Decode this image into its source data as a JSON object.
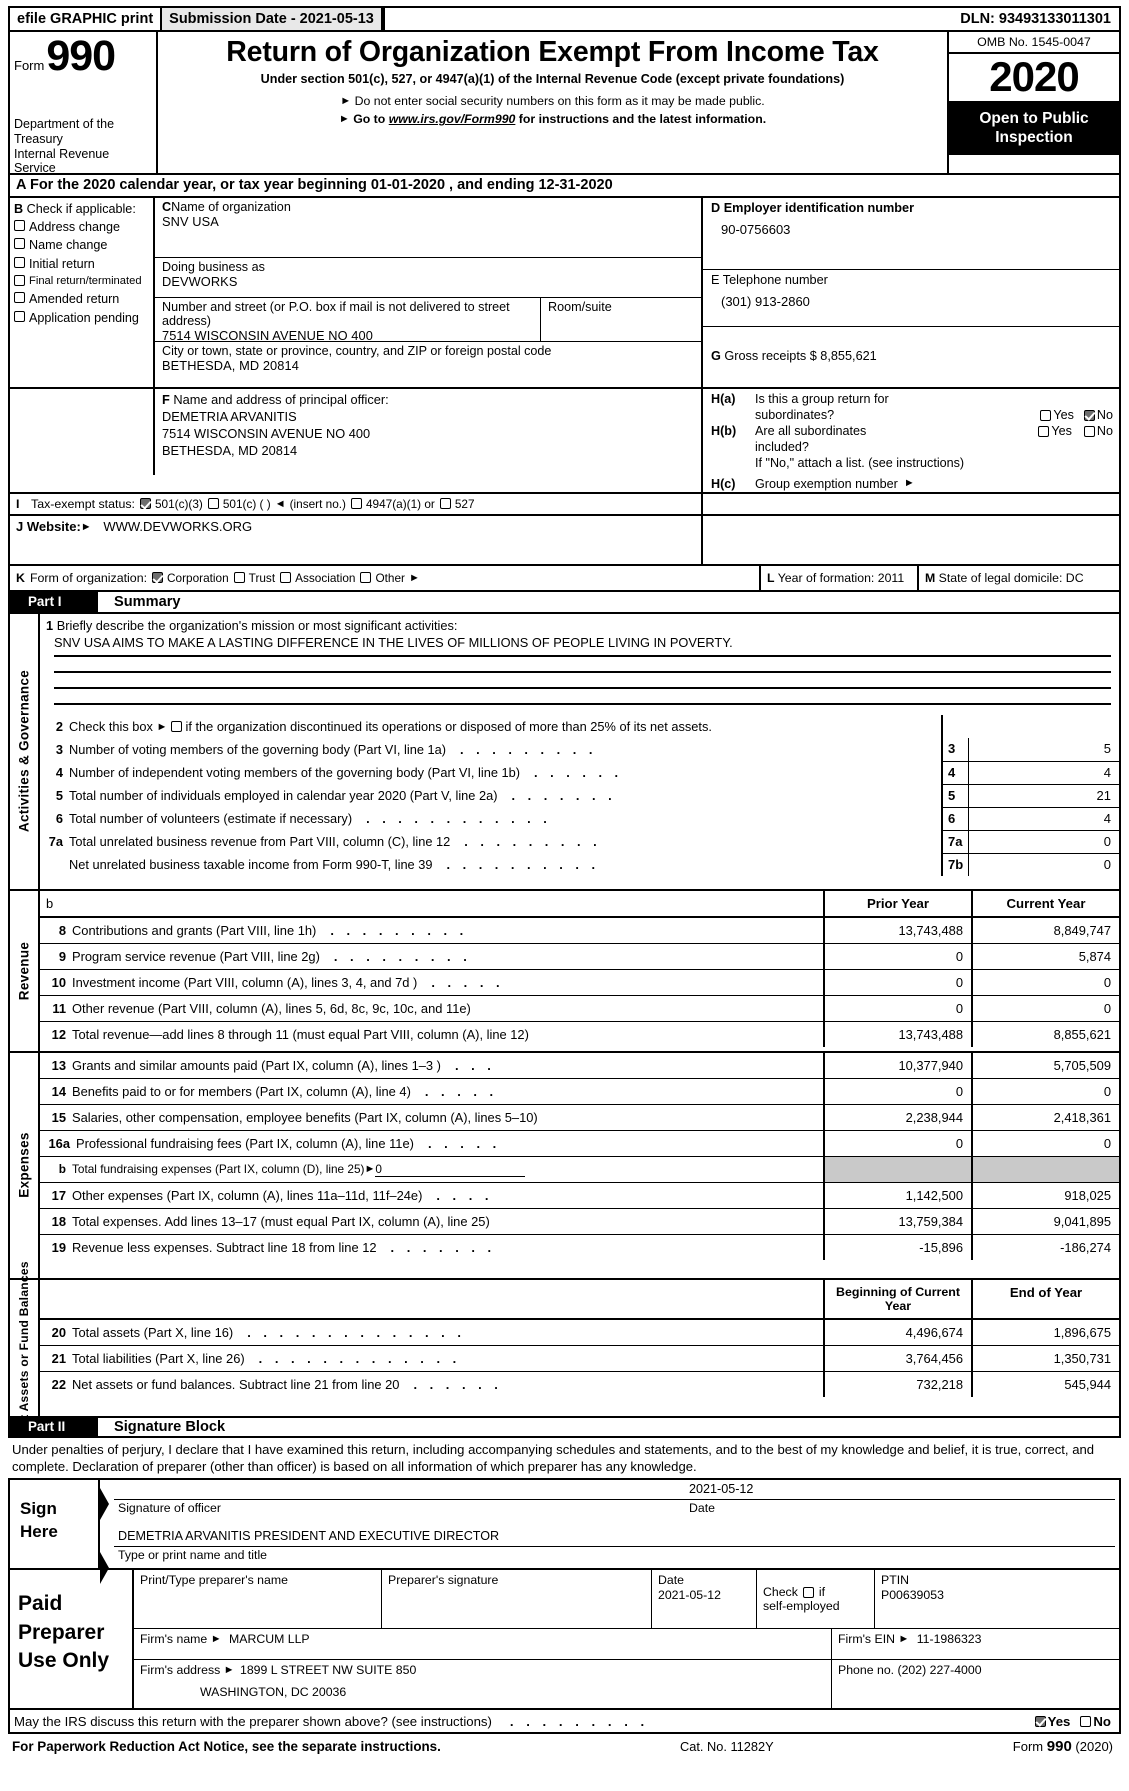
{
  "efile": {
    "print_label": "efile GRAPHIC print",
    "submission_label": "Submission Date - 2021-05-13",
    "dln_label": "DLN: 93493133011301"
  },
  "masthead": {
    "form_word": "Form",
    "form_number": "990",
    "department": "Department of the Treasury Internal Revenue Service",
    "title": "Return of Organization Exempt From Income Tax",
    "subtitle": "Under section 501(c), 527, or 4947(a)(1) of the Internal Revenue Code (except private foundations)",
    "note1": "Do not enter social security numbers on this form as it may be made public.",
    "note2_prefix": "Go to",
    "note2_link": "www.irs.gov/Form990",
    "note2_suffix": "for instructions and the latest information.",
    "omb": "OMB No. 1545-0047",
    "year": "2020",
    "open_to_public": "Open to Public Inspection"
  },
  "line_a": {
    "letter": "A",
    "text": "For the 2020 calendar year, or tax year beginning 01-01-2020   , and ending 12-31-2020"
  },
  "section_b": {
    "letter": "B",
    "heading": "Check if applicable:",
    "items": [
      {
        "label": "Address change",
        "checked": false
      },
      {
        "label": "Name change",
        "checked": false
      },
      {
        "label": "Initial return",
        "checked": false
      },
      {
        "label": "Final return/terminated",
        "checked": false
      },
      {
        "label": "Amended return",
        "checked": false
      },
      {
        "label": "Application pending",
        "checked": false
      }
    ]
  },
  "section_c": {
    "letter": "C",
    "name_label": "Name of organization",
    "name_value": "SNV USA",
    "dba_label": "Doing business as",
    "dba_value": "DEVWORKS",
    "street_label": "Number and street (or P.O. box if mail is not delivered to street address)",
    "street_value": "7514 WISCONSIN AVENUE NO 400",
    "room_label": "Room/suite",
    "room_value": "",
    "city_label": "City or town, state or province, country, and ZIP or foreign postal code",
    "city_value": "BETHESDA, MD  20814"
  },
  "section_d": {
    "letter": "D",
    "ein_label": "Employer identification number",
    "ein_value": "90-0756603",
    "phone_letter": "E",
    "phone_label": "Telephone number",
    "phone_value": "(301) 913-2860",
    "gross_letter": "G",
    "gross_label": "Gross receipts $ 8,855,621"
  },
  "section_f": {
    "letter": "F",
    "label": "Name and address of principal officer:",
    "officer_name": "DEMETRIA ARVANITIS",
    "officer_street": "7514 WISCONSIN AVENUE NO 400",
    "officer_city": "BETHESDA, MD  20814"
  },
  "section_h": {
    "ha_label": "H(a)",
    "ha_q1": "Is this a group return for",
    "ha_q2": "subordinates?",
    "ha_yes": "Yes",
    "ha_no": "No",
    "ha_yes_checked": false,
    "ha_no_checked": true,
    "hb_label": "H(b)",
    "hb_q1": "Are all subordinates",
    "hb_q2": "included?",
    "hb_yes": "Yes",
    "hb_no": "No",
    "hb_yes_checked": false,
    "hb_no_checked": false,
    "hb_note": "If \"No,\" attach a list. (see instructions)",
    "hc_label": "H(c)",
    "hc_text": "Group exemption number"
  },
  "section_i": {
    "letter": "I",
    "label": "Tax-exempt status:",
    "opt1": "501(c)(3)",
    "opt1_checked": true,
    "opt2": "501(c) (   )",
    "opt2_checked": false,
    "opt2_suffix": "(insert no.)",
    "opt3": "4947(a)(1) or",
    "opt3_checked": false,
    "opt4": "527",
    "opt4_checked": false
  },
  "section_j": {
    "letter": "J",
    "label": "Website:",
    "value": "WWW.DEVWORKS.ORG"
  },
  "section_k": {
    "letter": "K",
    "label": "Form of organization:",
    "opt1": "Corporation",
    "opt1_checked": true,
    "opt2": "Trust",
    "opt2_checked": false,
    "opt3": "Association",
    "opt3_checked": false,
    "opt4": "Other",
    "opt4_checked": false,
    "l_label": "Year of formation: 2011",
    "l_letter": "L",
    "m_letter": "M",
    "m_label": "State of legal domicile: DC"
  },
  "part1": {
    "part_label": "Part I",
    "part_title": "Summary",
    "sidetab_activities": "Activities & Governance",
    "sidetab_revenue": "Revenue",
    "sidetab_expenses": "Expenses",
    "sidetab_netassets": "Net Assets or Fund Balances",
    "mission_num": "1",
    "mission_label": "Briefly describe the organization's mission or most significant activities:",
    "mission_text": "SNV USA AIMS TO MAKE A LASTING DIFFERENCE IN THE LIVES OF MILLIONS OF PEOPLE LIVING IN POVERTY.",
    "line2_num": "2",
    "line2_text_a": "Check this box",
    "line2_text_b": "if the organization discontinued its operations or disposed of more than 25% of its net assets.",
    "line2_checked": false,
    "gov_rows": [
      {
        "num": "3",
        "label": "Number of voting members of the governing body (Part VI, line 1a)",
        "dots": ". . . . . . . . .",
        "box": "3",
        "value": "5"
      },
      {
        "num": "4",
        "label": "Number of independent voting members of the governing body (Part VI, line 1b)",
        "dots": ". . . . . .",
        "box": "4",
        "value": "4"
      },
      {
        "num": "5",
        "label": "Total number of individuals employed in calendar year 2020 (Part V, line 2a)",
        "dots": ". . . . . . .",
        "box": "5",
        "value": "21"
      },
      {
        "num": "6",
        "label": "Total number of volunteers (estimate if necessary)",
        "dots": ". . . . . . . . . . . .",
        "box": "6",
        "value": "4"
      },
      {
        "num": "7a",
        "label": "Total unrelated business revenue from Part VIII, column (C), line 12",
        "dots": ". . . . . . . . .",
        "box": "7a",
        "value": "0"
      },
      {
        "num": "",
        "label": "Net unrelated business taxable income from Form 990-T, line 39",
        "dots": ". . . . . . . . . .",
        "box": "7b",
        "value": "0"
      }
    ],
    "stray_b": "b",
    "col_prior": "Prior Year",
    "col_current": "Current Year",
    "col_begin": "Beginning of Current Year",
    "col_end": "End of Year",
    "revenue_rows": [
      {
        "num": "8",
        "label": "Contributions and grants (Part VIII, line 1h)",
        "dots": ". . . . . . . . .",
        "prior": "13,743,488",
        "current": "8,849,747"
      },
      {
        "num": "9",
        "label": "Program service revenue (Part VIII, line 2g)",
        "dots": ". . . . . . . . .",
        "prior": "0",
        "current": "5,874"
      },
      {
        "num": "10",
        "label": "Investment income (Part VIII, column (A), lines 3, 4, and 7d )",
        "dots": ". . . . .",
        "prior": "0",
        "current": "0"
      },
      {
        "num": "11",
        "label": "Other revenue (Part VIII, column (A), lines 5, 6d, 8c, 9c, 10c, and 11e)",
        "dots": "",
        "prior": "0",
        "current": "0"
      },
      {
        "num": "12",
        "label": "Total revenue—add lines 8 through 11 (must equal Part VIII, column (A), line 12)",
        "dots": "",
        "prior": "13,743,488",
        "current": "8,855,621"
      }
    ],
    "expense_rows": [
      {
        "num": "13",
        "label": "Grants and similar amounts paid (Part IX, column (A), lines 1–3 )",
        "dots": ". . .",
        "prior": "10,377,940",
        "current": "5,705,509"
      },
      {
        "num": "14",
        "label": "Benefits paid to or for members (Part IX, column (A), line 4)",
        "dots": ". . . . .",
        "prior": "0",
        "current": "0"
      },
      {
        "num": "15",
        "label": "Salaries, other compensation, employee benefits (Part IX, column (A), lines 5–10)",
        "dots": "",
        "prior": "2,238,944",
        "current": "2,418,361"
      },
      {
        "num": "16a",
        "label": "Professional fundraising fees (Part IX, column (A), line 11e)",
        "dots": ". . . . .",
        "prior": "0",
        "current": "0"
      }
    ],
    "line16b_num": "b",
    "line16b_label": "Total fundraising expenses (Part IX, column (D), line 25)",
    "line16b_value": "0",
    "expense_rows2": [
      {
        "num": "17",
        "label": "Other expenses (Part IX, column (A), lines 11a–11d, 11f–24e)",
        "dots": ". . . .",
        "prior": "1,142,500",
        "current": "918,025"
      },
      {
        "num": "18",
        "label": "Total expenses. Add lines 13–17 (must equal Part IX, column (A), line 25)",
        "dots": "",
        "prior": "13,759,384",
        "current": "9,041,895"
      },
      {
        "num": "19",
        "label": "Revenue less expenses. Subtract line 18 from line 12",
        "dots": ". . . . . . .",
        "prior": "-15,896",
        "current": "-186,274"
      }
    ],
    "netasset_rows": [
      {
        "num": "20",
        "label": "Total assets (Part X, line 16)",
        "dots": ". . . . . . . . . . . . . .",
        "prior": "4,496,674",
        "current": "1,896,675"
      },
      {
        "num": "21",
        "label": "Total liabilities (Part X, line 26)",
        "dots": ". . . . . . . . . . . . .",
        "prior": "3,764,456",
        "current": "1,350,731"
      },
      {
        "num": "22",
        "label": "Net assets or fund balances. Subtract line 21 from line 20",
        "dots": ". . . . . .",
        "prior": "732,218",
        "current": "545,944"
      }
    ]
  },
  "part2": {
    "part_label": "Part II",
    "part_title": "Signature Block",
    "perjury_text": "Under penalties of perjury, I declare that I have examined this return, including accompanying schedules and statements, and to the best of my knowledge and belief, it is true, correct, and complete. Declaration of preparer (other than officer) is based on all information of which preparer has any knowledge.",
    "sign_here": "Sign Here",
    "officer_sig_caption": "Signature of officer",
    "date_value": "2021-05-12",
    "date_caption": "Date",
    "officer_name_title": "DEMETRIA ARVANITIS  PRESIDENT AND EXECUTIVE DIRECTOR",
    "name_title_caption": "Type or print name and title",
    "paid_preparer_label": "Paid Preparer Use Only",
    "prep_name_label": "Print/Type preparer's name",
    "prep_name_value": "",
    "prep_sig_label": "Preparer's signature",
    "prep_sig_value": "",
    "prep_date_label": "Date",
    "prep_date_value": "2021-05-12",
    "check_label": "Check",
    "check_if": "if",
    "self_employed_label": "self-employed",
    "self_employed_checked": false,
    "ptin_label": "PTIN",
    "ptin_value": "P00639053",
    "firm_name_label": "Firm's name",
    "firm_name_value": "MARCUM LLP",
    "firm_ein_label": "Firm's EIN",
    "firm_ein_value": "11-1986323",
    "firm_addr_label": "Firm's address",
    "firm_addr_value": "1899 L STREET NW SUITE 850",
    "firm_addr_value2": "WASHINGTON, DC  20036",
    "phone_label": "Phone no. (202) 227-4000",
    "irs_discuss": "May the IRS discuss this return with the preparer shown above? (see instructions)",
    "irs_dots": ". . . . . . . . .",
    "irs_yes": "Yes",
    "irs_no": "No",
    "irs_yes_checked": true,
    "irs_no_checked": false
  },
  "footer": {
    "paperwork": "For Paperwork Reduction Act Notice, see the separate instructions.",
    "cat": "Cat. No. 11282Y",
    "form_prefix": "Form",
    "form_num": "990",
    "form_year": "(2020)"
  }
}
